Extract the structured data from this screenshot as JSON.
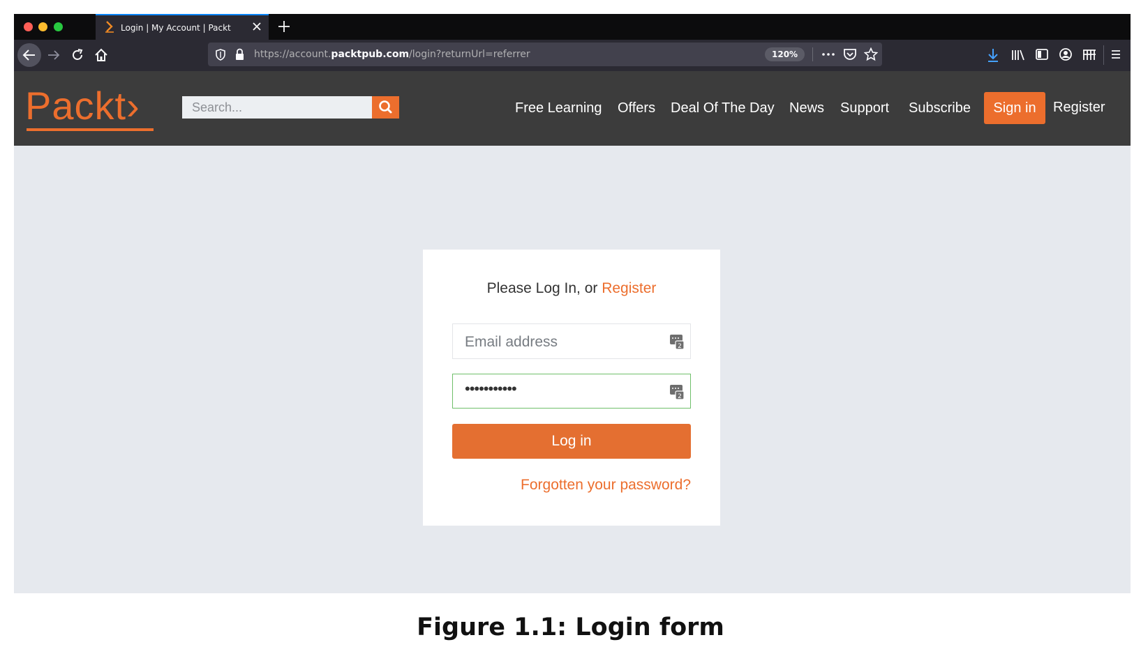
{
  "browser": {
    "tab_title": "Login | My Account | Packt",
    "url_prefix": "https://account.",
    "url_domain": "packtpub.com",
    "url_path": "/login?returnUrl=referrer",
    "zoom": "120%",
    "icons": [
      "back-arrow-icon",
      "forward-arrow-icon",
      "reload-icon",
      "home-icon",
      "shield-icon",
      "lock-icon",
      "more-icon",
      "pocket-icon",
      "star-icon",
      "download-icon",
      "library-icon",
      "sidebar-icon",
      "account-icon",
      "extensions-icon",
      "menu-icon"
    ],
    "accent_color": "#0a84ff"
  },
  "site": {
    "logo_text": "Packt›",
    "brand_color": "#ec6e2d",
    "search_placeholder": "Search...",
    "nav": [
      "Free Learning",
      "Offers",
      "Deal Of The Day",
      "News",
      "Support",
      "Subscribe"
    ],
    "sign_in": "Sign in",
    "register": "Register"
  },
  "login": {
    "heading_prefix": "Please Log In, or ",
    "heading_link": "Register",
    "email_placeholder": "Email address",
    "password_value": "•••••••••••",
    "submit": "Log in",
    "forgot": "Forgotten your password?"
  },
  "caption": "Figure 1.1: Login form"
}
